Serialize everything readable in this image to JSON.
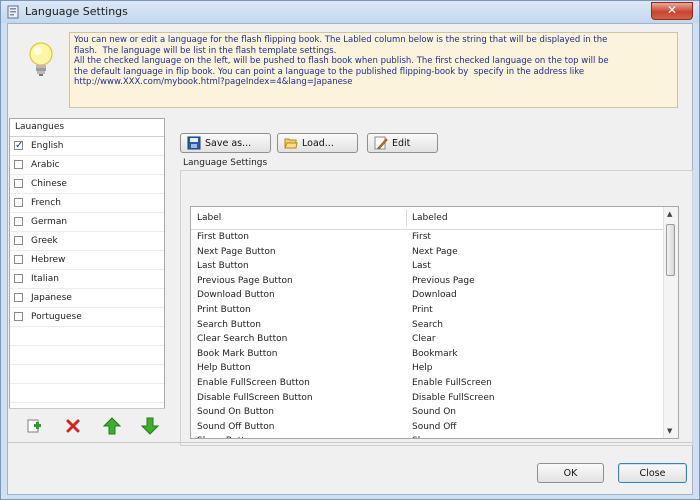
{
  "window": {
    "title": "Language Settings",
    "close_glyph": "✕"
  },
  "info": {
    "text": "You can new or edit a language for the flash flipping book. The Labled column below is the string that will be displayed in the\nflash.  The language will be list in the flash template settings.\nAll the checked language on the left, will be pushed to flash book when publish. The first checked language on the top will be\nthe default language in flip book. You can point a language to the published flipping-book by  specify in the address like\nhttp://www.XXX.com/mybook.html?pageIndex=4&lang=Japanese"
  },
  "languages": {
    "header": "Lauangues",
    "items": [
      {
        "label": "English",
        "checked": true
      },
      {
        "label": "Arabic",
        "checked": false
      },
      {
        "label": "Chinese",
        "checked": false
      },
      {
        "label": "French",
        "checked": false
      },
      {
        "label": "German",
        "checked": false
      },
      {
        "label": "Greek",
        "checked": false
      },
      {
        "label": "Hebrew",
        "checked": false
      },
      {
        "label": "Italian",
        "checked": false
      },
      {
        "label": "Japanese",
        "checked": false
      },
      {
        "label": "Portuguese",
        "checked": false
      }
    ]
  },
  "toolbar": {
    "save_label": "Save as...",
    "load_label": "Load...",
    "edit_label": "Edit"
  },
  "group_label": "Language Settings",
  "table": {
    "col1": "Label",
    "col2": "Labeled",
    "rows": [
      [
        "First Button",
        "First"
      ],
      [
        "Next Page Button",
        "Next Page"
      ],
      [
        "Last Button",
        "Last"
      ],
      [
        "Previous Page Button",
        "Previous Page"
      ],
      [
        "Download Button",
        "Download"
      ],
      [
        "Print Button",
        "Print"
      ],
      [
        "Search Button",
        "Search"
      ],
      [
        "Clear Search Button",
        "Clear"
      ],
      [
        "Book Mark Button",
        "Bookmark"
      ],
      [
        "Help Button",
        "Help"
      ],
      [
        "Enable FullScreen Button",
        "Enable FullScreen"
      ],
      [
        "Disable FullScreen Button",
        "Disable FullScreen"
      ],
      [
        "Sound On Button",
        "Sound On"
      ],
      [
        "Sound Off Button",
        "Sound Off"
      ],
      [
        "Share Button",
        "Share"
      ]
    ]
  },
  "footer": {
    "ok_label": "OK",
    "close_label": "Close"
  }
}
